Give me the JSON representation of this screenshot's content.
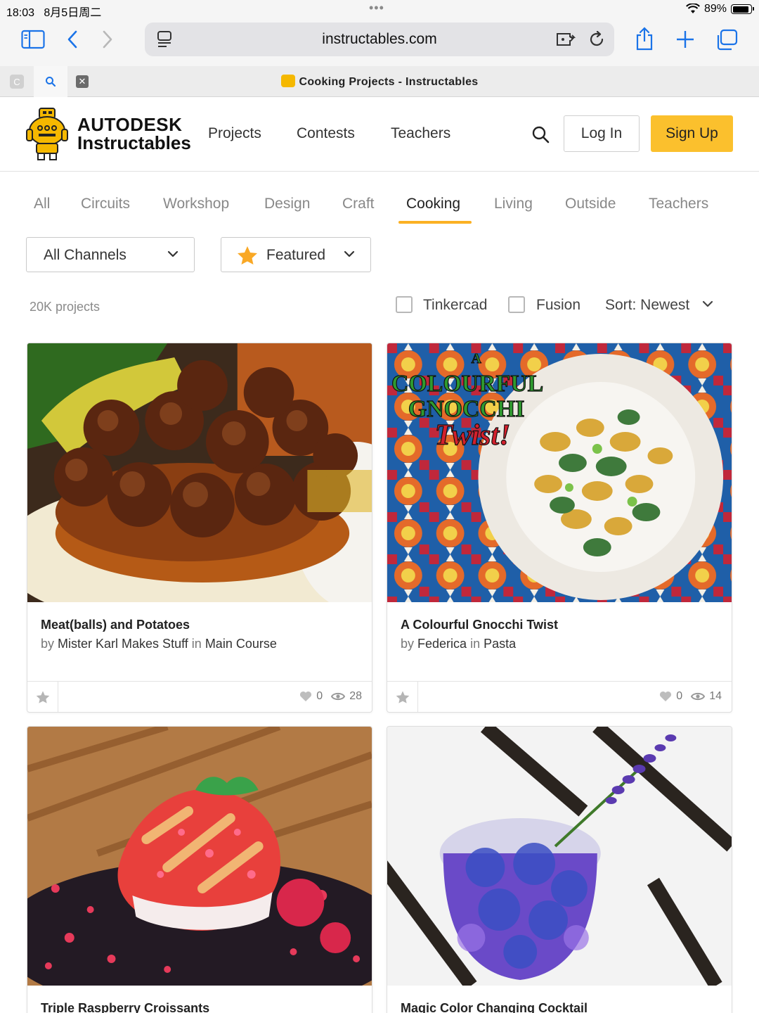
{
  "status_bar": {
    "time": "18:03",
    "date": "8月5日周二",
    "battery_percent": "89%",
    "battery_level": 0.89
  },
  "browser": {
    "url": "instructables.com",
    "tab_title": "Cooking Projects - Instructables",
    "icons": [
      "sidebar-icon",
      "back-icon",
      "forward-icon",
      "reader-icon",
      "translate-icon",
      "reload-icon",
      "share-icon",
      "new-tab-icon",
      "tabs-overview-icon"
    ]
  },
  "site": {
    "logo_line1": "AUTODESK",
    "logo_line2": "Instructables",
    "nav": [
      "Projects",
      "Contests",
      "Teachers"
    ],
    "login_label": "Log In",
    "signup_label": "Sign Up",
    "accent_color": "#fbc02d"
  },
  "categories": {
    "items": [
      "All",
      "Circuits",
      "Workshop",
      "Design",
      "Craft",
      "Cooking",
      "Living",
      "Outside",
      "Teachers"
    ],
    "active": "Cooking"
  },
  "filters": {
    "channel_select": "All Channels",
    "featured_select": "Featured",
    "project_count": "20K projects",
    "tinkercad_label": "Tinkercad",
    "fusion_label": "Fusion",
    "sort_label": "Sort: Newest"
  },
  "cards": [
    {
      "title": "Meat(balls) and Potatoes",
      "by": "by",
      "author": "Mister Karl Makes Stuff",
      "in": "in",
      "channel": "Main Course",
      "likes": "0",
      "views": "28"
    },
    {
      "title": "A Colourful Gnocchi Twist",
      "by": "by",
      "author": "Federica",
      "in": "in",
      "channel": "Pasta",
      "likes": "0",
      "views": "14",
      "image_text": [
        "A",
        "COLOURFUL",
        "GNOCCHI",
        "Twist!"
      ]
    },
    {
      "title": "Triple Raspberry Croissants"
    },
    {
      "title": "Magic Color Changing Cocktail"
    }
  ]
}
